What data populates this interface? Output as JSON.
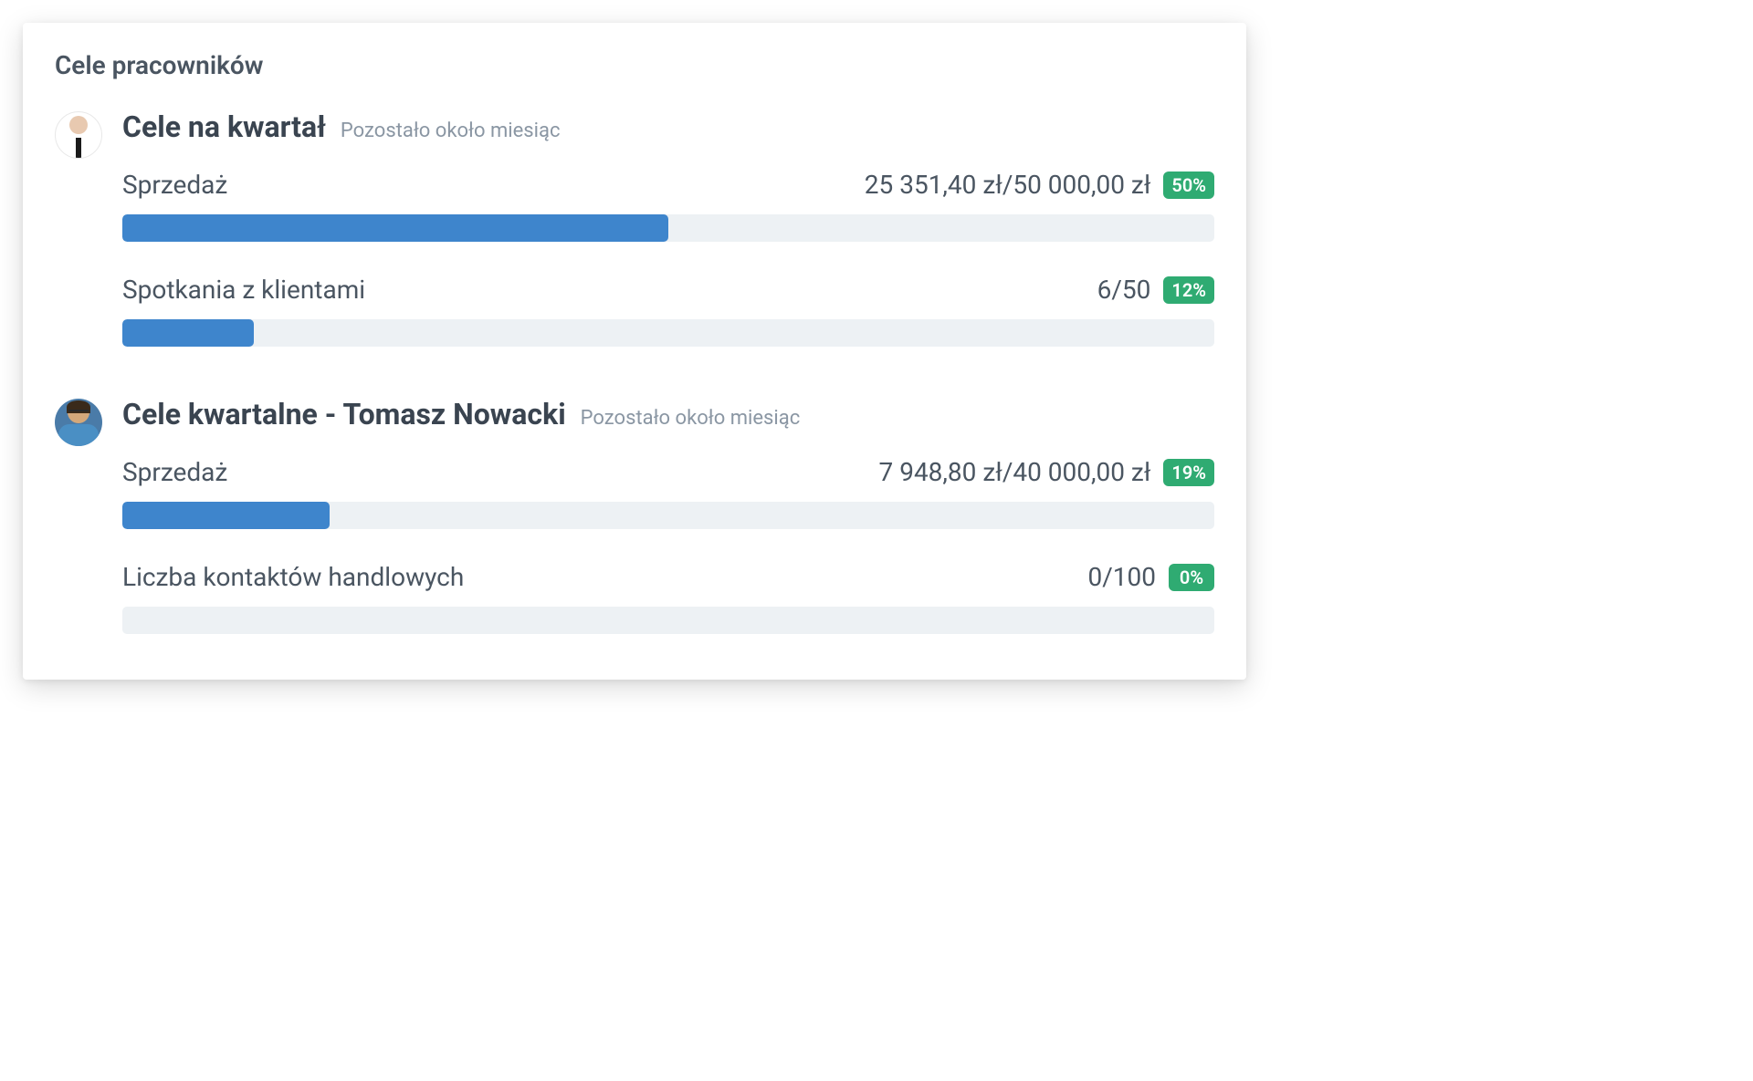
{
  "card": {
    "title": "Cele pracowników"
  },
  "employees": [
    {
      "title": "Cele na kwartał",
      "subtitle": "Pozostało około miesiąc",
      "goals": [
        {
          "label": "Sprzedaż",
          "value": "25 351,40 zł/50 000,00 zł",
          "percent": "50%",
          "fill": 50
        },
        {
          "label": "Spotkania z klientami",
          "value": "6/50",
          "percent": "12%",
          "fill": 12
        }
      ]
    },
    {
      "title": "Cele kwartalne - Tomasz Nowacki",
      "subtitle": "Pozostało około miesiąc",
      "goals": [
        {
          "label": "Sprzedaż",
          "value": "7 948,80 zł/40 000,00 zł",
          "percent": "19%",
          "fill": 19
        },
        {
          "label": "Liczba kontaktów handlowych",
          "value": "0/100",
          "percent": "0%",
          "fill": 0
        }
      ]
    }
  ],
  "colors": {
    "progress_fill": "#3e85cc",
    "progress_bg": "#edf1f4",
    "badge_bg": "#2fab72"
  }
}
